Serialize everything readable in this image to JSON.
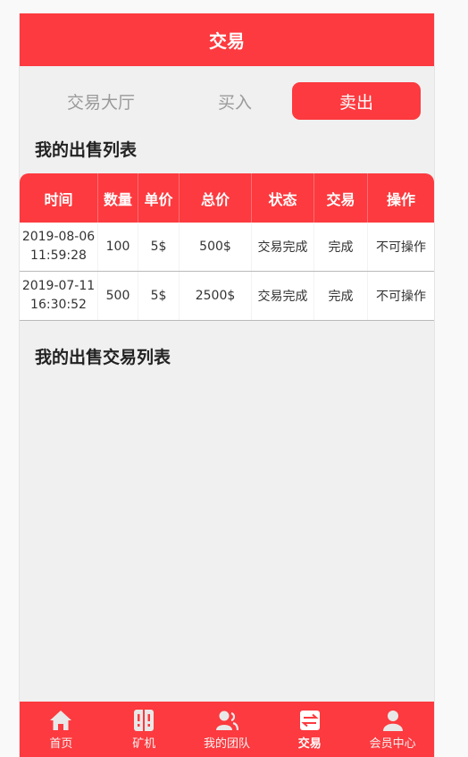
{
  "header": {
    "title": "交易"
  },
  "tabs": [
    {
      "label": "交易大厅"
    },
    {
      "label": "买入"
    },
    {
      "label": "卖出"
    }
  ],
  "sections": {
    "sell_list_title": "我的出售列表",
    "sell_trade_list_title": "我的出售交易列表"
  },
  "table": {
    "headers": [
      "时间",
      "数量",
      "单价",
      "总价",
      "状态",
      "交易",
      "操作"
    ],
    "rows": [
      {
        "date": "2019-08-06",
        "time": "11:59:28",
        "qty": "100",
        "price": "5$",
        "total": "500$",
        "status": "交易完成",
        "trade": "完成",
        "action": "不可操作"
      },
      {
        "date": "2019-07-11",
        "time": "16:30:52",
        "qty": "500",
        "price": "5$",
        "total": "2500$",
        "status": "交易完成",
        "trade": "完成",
        "action": "不可操作"
      }
    ]
  },
  "nav": [
    {
      "label": "首页",
      "icon": "home-icon"
    },
    {
      "label": "矿机",
      "icon": "miner-icon"
    },
    {
      "label": "我的团队",
      "icon": "team-icon"
    },
    {
      "label": "交易",
      "icon": "exchange-icon"
    },
    {
      "label": "会员中心",
      "icon": "user-icon"
    }
  ],
  "colors": {
    "accent": "#fc3a3f",
    "background": "#f0f0f0"
  }
}
